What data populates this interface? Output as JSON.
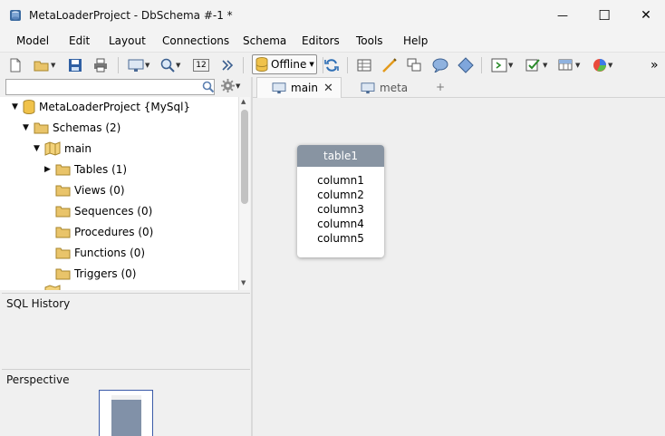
{
  "window": {
    "title": "MetaLoaderProject - DbSchema #-1 *",
    "minimize_glyph": "—",
    "maximize_glyph": "☐",
    "close_glyph": "✕"
  },
  "menu": [
    "Model",
    "Edit",
    "Layout",
    "Connections",
    "Schema",
    "Editors",
    "Tools",
    "Help"
  ],
  "toolbar": {
    "connection_status": "Offline",
    "zoom_value": "12",
    "icons": [
      "new-file-icon",
      "open-folder-icon",
      "save-icon",
      "print-icon",
      "screen-icon",
      "zoom-icon",
      "zoom-level-icon",
      "forward-icon",
      "database-icon",
      "refresh-icon",
      "grid-icon",
      "pencil-icon",
      "duplicate-icon",
      "comment-icon",
      "diamond-icon",
      "query-icon",
      "checklist-icon",
      "table-editor-icon",
      "chart-icon",
      "overflow-icon"
    ],
    "overflow_glyph": "»"
  },
  "tree": {
    "project": "MetaLoaderProject {MySql}",
    "schemas": "Schemas (2)",
    "schema_main": "main",
    "tables": "Tables (1)",
    "views": "Views (0)",
    "sequences": "Sequences (0)",
    "procedures": "Procedures (0)",
    "functions": "Functions (0)",
    "triggers": "Triggers (0)"
  },
  "panels": {
    "sql_history": "SQL History",
    "perspective": "Perspective"
  },
  "tabs": {
    "main": "main",
    "meta": "meta",
    "add": "+",
    "close_glyph": "✕"
  },
  "diagram": {
    "table_name": "table1",
    "columns": [
      "column1",
      "column2",
      "column3",
      "column4",
      "column5"
    ]
  },
  "colors": {
    "table_header": "#8894a2",
    "folder": "#e9c46a",
    "accent_blue": "#3a5aa8"
  }
}
